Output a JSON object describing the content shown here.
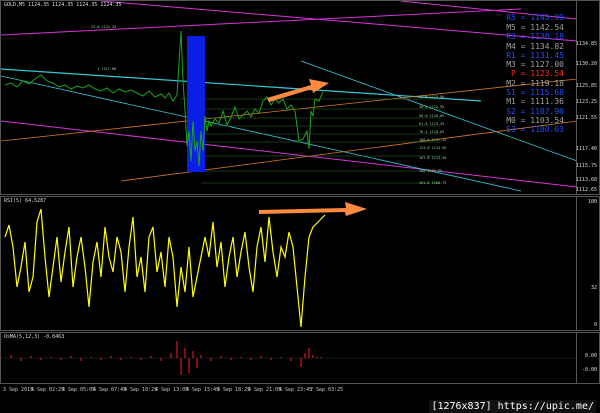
{
  "main": {
    "label": "GOLD,M5  1124.35 1124.35 1124.35 1124.35",
    "price_ticks": [
      "1134.85",
      "1130.20",
      "1125.85",
      "1123.25",
      "1121.55",
      "1117.40",
      "1115.75",
      "1113.68",
      "1112.65"
    ],
    "levels": [
      {
        "text": "R5 = 1145.99",
        "color": "#1e4dff"
      },
      {
        "text": "M5 = 1142.54",
        "color": "#a0a0a0"
      },
      {
        "text": "R3 = 1138.18",
        "color": "#1e4dff"
      },
      {
        "text": "M4 = 1134.82",
        "color": "#a0a0a0"
      },
      {
        "text": "R1 = 1131.45",
        "color": "#1e4dff"
      },
      {
        "text": "M3 = 1127.00",
        "color": "#a0a0a0"
      },
      {
        "text": "P  = 1123.54",
        "color": "#ff2a2a"
      },
      {
        "text": "M2 = 1119.18",
        "color": "#a0a0a0"
      },
      {
        "text": "S1 = 1115.68",
        "color": "#1e4dff"
      },
      {
        "text": "M1 = 1111.36",
        "color": "#a0a0a0"
      },
      {
        "text": "S2 = 1107.90",
        "color": "#1e4dff"
      },
      {
        "text": "M0 = 1103.54",
        "color": "#a0a0a0"
      },
      {
        "text": "S3 = 1100.03",
        "color": "#1e4dff"
      }
    ],
    "fib_labels": [
      "23.6 1131.35",
      "1 1127.88",
      "23.6 1123.00",
      "38.2 1122.95",
      "50.0 1120.85",
      "61.8 1119.35",
      "76.4 1118.65",
      "100.0 1117.25",
      "123.6 1115.90",
      "161.8 1113.30",
      "200 1111.95",
      "261.8 1108.75"
    ]
  },
  "rsi": {
    "label": "RSI(5) 64.5287",
    "ticks": [
      "100",
      "32",
      "0"
    ]
  },
  "osma": {
    "label": "OsMA(5,12,3) -0.0463",
    "ticks": [
      "0.00",
      "-0.00"
    ]
  },
  "time_axis": [
    "3 Sep 2015",
    "4 Sep 02:25",
    "4 Sep 05:05",
    "4 Sep 07:45",
    "4 Sep 10:25",
    "4 Sep 13:05",
    "4 Sep 15:45",
    "4 Sep 18:25",
    "4 Sep 21:05",
    "4 Sep 23:45",
    "7 Sep 03:25"
  ],
  "watermark": "[1276x837] https://upic.me/",
  "colors": {
    "price_line": "#19a619",
    "rsi_line": "#ffff00",
    "osma_bar": "#ff2020",
    "arrow": "#ff8a40",
    "box": "#0a1ee6",
    "channel_magenta": "#d633d6",
    "channel_cyan": "#35c8d8",
    "channel_orange": "#d77a2a"
  }
}
